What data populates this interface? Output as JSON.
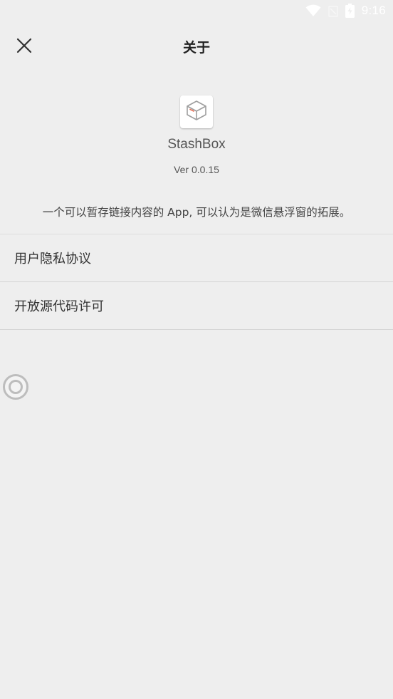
{
  "status_bar": {
    "time": "9:16",
    "icons": [
      "wifi-icon",
      "signal-off-icon",
      "battery-charging-icon"
    ]
  },
  "app_bar": {
    "title": "关于",
    "close_icon": "close-icon"
  },
  "app_info": {
    "icon": "box-icon",
    "name": "StashBox",
    "version": "Ver 0.0.15",
    "description": "一个可以暂存链接内容的 App, 可以认为是微信悬浮窗的拓展。"
  },
  "menu": {
    "items": [
      {
        "label": "用户隐私协议"
      },
      {
        "label": "开放源代码许可"
      }
    ]
  },
  "colors": {
    "background": "#eeeeee",
    "divider": "#d4d4d4",
    "accent_box_line": "#e8735a"
  }
}
